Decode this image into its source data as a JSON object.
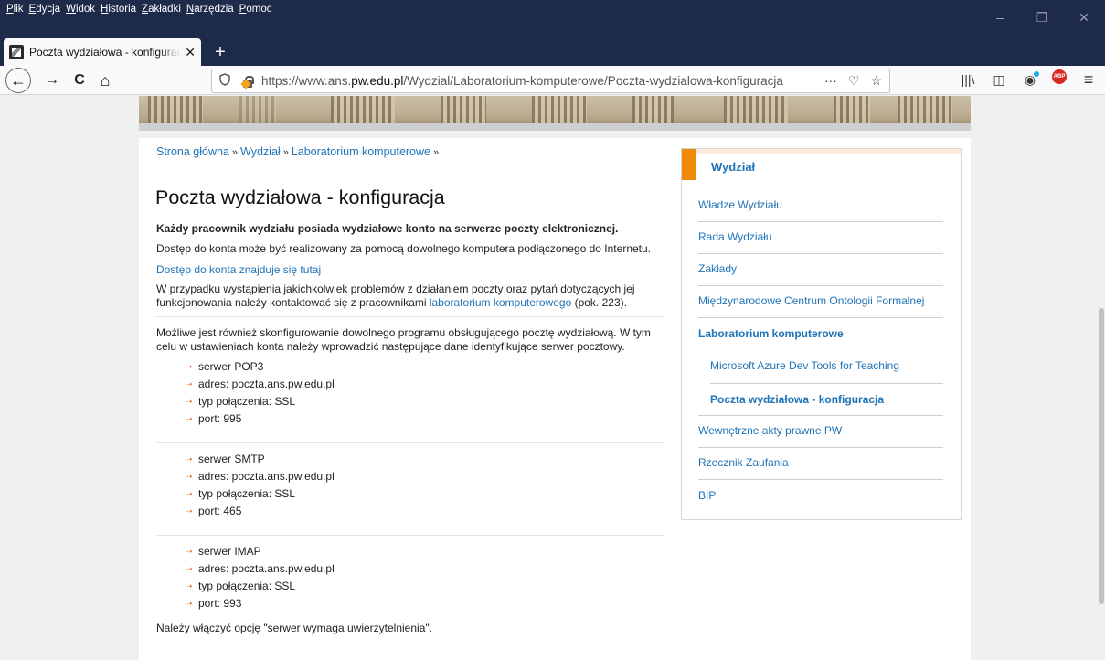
{
  "menu": [
    "Plik",
    "Edycja",
    "Widok",
    "Historia",
    "Zakładki",
    "Narzędzia",
    "Pomoc"
  ],
  "window_controls": {
    "minimize": "–",
    "restore": "❐",
    "close": "✕"
  },
  "tab": {
    "title": "Poczta wydziałowa - konfiguracja",
    "close": "✕",
    "new_tab": "+"
  },
  "nav": {
    "back": "←",
    "forward": "→",
    "reload": "C",
    "home": "⌂"
  },
  "url": {
    "prefix": "https://www.ans.",
    "domain": "pw.edu.pl",
    "path": "/Wydzial/Laboratorium-komputerowe/Poczta-wydzialowa-konfiguracja",
    "more": "···",
    "pocket": "♡",
    "bookmark": "☆"
  },
  "toolbar_icons": {
    "library": "|||\\",
    "sidebar": "◫",
    "account": "◉",
    "adblock": "ABP",
    "menu": "≡"
  },
  "breadcrumb": {
    "items": [
      "Strona główna",
      "Wydział",
      "Laboratorium komputerowe"
    ],
    "separator": "»"
  },
  "heading": "Poczta wydziałowa - konfiguracja",
  "content": {
    "intro_bold": "Każdy pracownik wydziału posiada wydziałowe konto na serwerze poczty elektronicznej.",
    "p1": "Dostęp do konta może być realizowany za pomocą dowolnego komputera podłączonego do Internetu.",
    "access_link": "Dostęp do konta znajduje się tutaj",
    "p2_before": "W przypadku wystąpienia jakichkolwiek problemów z działaniem poczty oraz pytań dotyczących jej funkcjonowania należy kontaktować się z pracownikami ",
    "p2_link": "laboratorium komputerowego",
    "p2_after": " (pok. 223).",
    "p3": "Możliwe jest również skonfigurowanie dowolnego programu obsługującego pocztę wydziałową. W tym celu w ustawieniach konta należy wprowadzić następujące dane identyfikujące serwer pocztowy.",
    "servers": [
      [
        "serwer POP3",
        "adres: poczta.ans.pw.edu.pl",
        "typ połączenia: SSL",
        "port: 995"
      ],
      [
        "serwer SMTP",
        "adres: poczta.ans.pw.edu.pl",
        "typ połączenia: SSL",
        "port: 465"
      ],
      [
        "serwer IMAP",
        "adres: poczta.ans.pw.edu.pl",
        "typ połączenia: SSL",
        "port: 993"
      ]
    ],
    "footer": "Należy włączyć opcję \"serwer wymaga uwierzytelnienia\"."
  },
  "sidebar": {
    "title": "Wydział",
    "items": [
      {
        "label": "Władze Wydziału",
        "level": 0,
        "bold": false
      },
      {
        "label": "Rada Wydziału",
        "level": 0,
        "bold": false
      },
      {
        "label": "Zakłady",
        "level": 0,
        "bold": false
      },
      {
        "label": "Międzynarodowe Centrum Ontologii Formalnej",
        "level": 0,
        "bold": false
      },
      {
        "label": "Laboratorium komputerowe",
        "level": 0,
        "bold": true
      },
      {
        "label": "Microsoft Azure Dev Tools for Teaching",
        "level": 1,
        "bold": false
      },
      {
        "label": "Poczta wydziałowa - konfiguracja",
        "level": 1,
        "bold": true
      },
      {
        "label": "Wewnętrzne akty prawne PW",
        "level": 0,
        "bold": false
      },
      {
        "label": "Rzecznik Zaufania",
        "level": 0,
        "bold": false
      },
      {
        "label": "BIP",
        "level": 0,
        "bold": false
      }
    ]
  },
  "colors": {
    "link": "#1f73b7",
    "accent": "#f18a07",
    "chrome": "#1e2a4a"
  }
}
